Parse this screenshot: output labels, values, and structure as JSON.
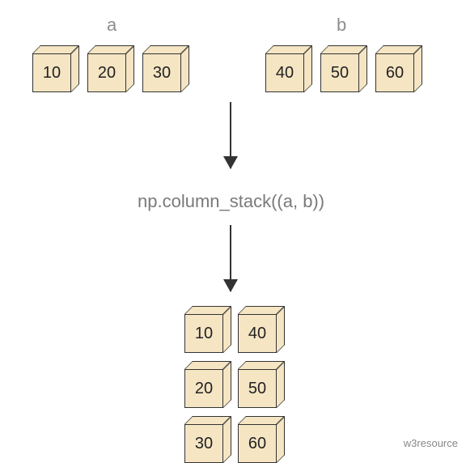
{
  "labels": {
    "a": "a",
    "b": "b"
  },
  "arrays": {
    "a": [
      "10",
      "20",
      "30"
    ],
    "b": [
      "40",
      "50",
      "60"
    ]
  },
  "operation": "np.column_stack((a, b))",
  "result": [
    [
      "10",
      "40"
    ],
    [
      "20",
      "50"
    ],
    [
      "30",
      "60"
    ]
  ],
  "attribution": "w3resource"
}
